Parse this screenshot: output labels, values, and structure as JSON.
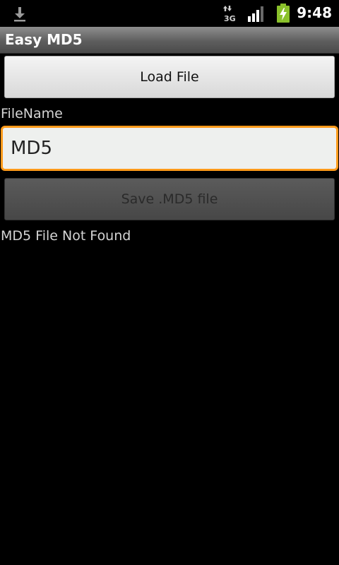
{
  "status_bar": {
    "time": "9:48",
    "network": "3G",
    "icons": [
      "download-icon",
      "network-3g-icon",
      "signal-icon",
      "battery-charging-icon"
    ],
    "accent_color": "#8ac12b"
  },
  "app": {
    "title": "Easy MD5"
  },
  "main": {
    "load_button_label": "Load File",
    "filename_label": "FileName",
    "filename_value": "MD5",
    "save_button_label": "Save .MD5 file",
    "status_message": "MD5 File Not Found"
  },
  "colors": {
    "focus_border": "#ff9a1a",
    "background": "#000000"
  }
}
